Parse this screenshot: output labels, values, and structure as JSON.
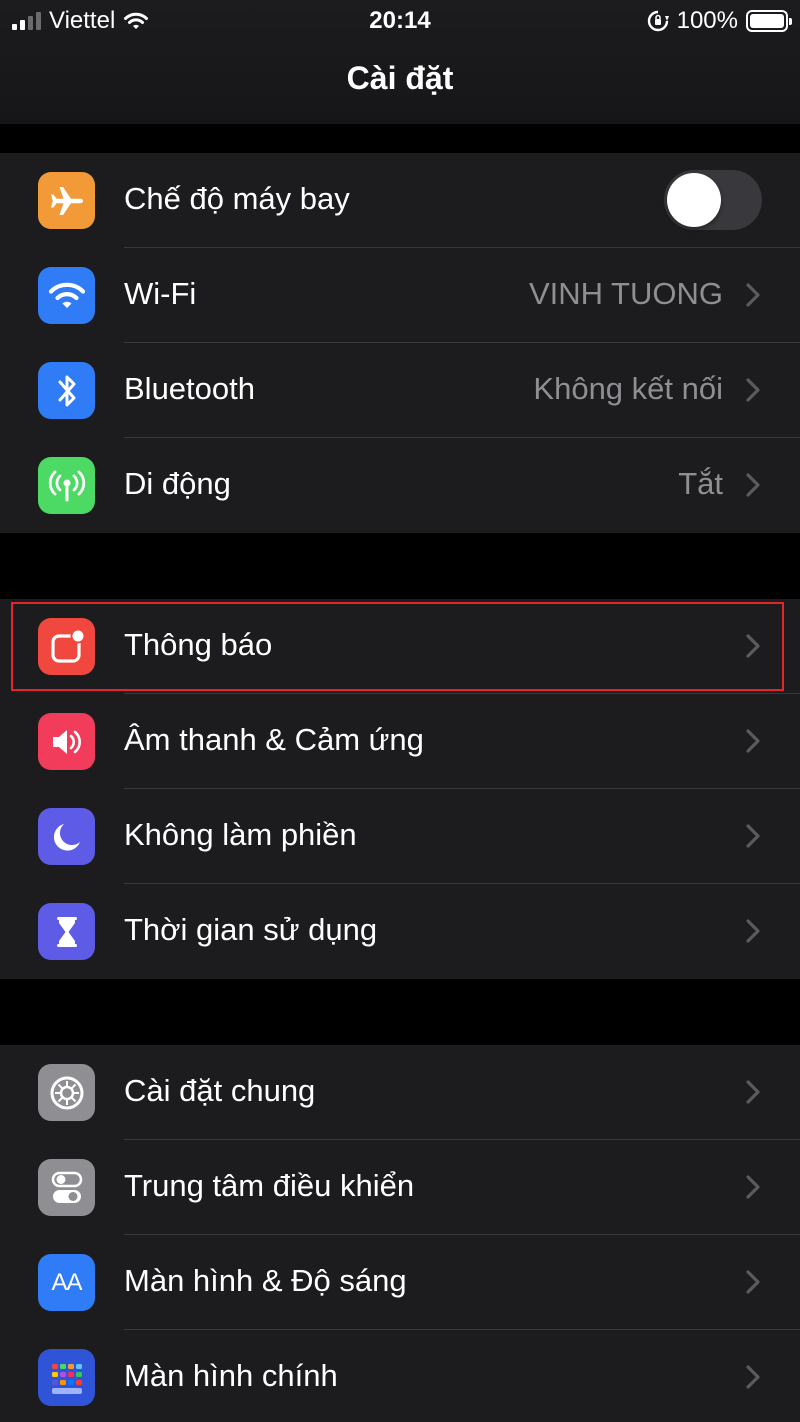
{
  "status_bar": {
    "carrier": "Viettel",
    "time": "20:14",
    "battery": "100%"
  },
  "header": {
    "title": "Cài đặt"
  },
  "groups": [
    {
      "items": [
        {
          "label": "Chế độ máy bay",
          "icon": "airplane-icon",
          "color": "#f19a37",
          "toggle": false
        },
        {
          "label": "Wi-Fi",
          "value": "VINH TUONG",
          "icon": "wifi-icon",
          "color": "#2f7cf6"
        },
        {
          "label": "Bluetooth",
          "value": "Không kết nối",
          "icon": "bluetooth-icon",
          "color": "#2f7cf6"
        },
        {
          "label": "Di động",
          "value": "Tắt",
          "icon": "antenna-icon",
          "color": "#4cd964"
        }
      ]
    },
    {
      "items": [
        {
          "label": "Thông báo",
          "icon": "notifications-icon",
          "color": "#f0483e",
          "highlighted": true
        },
        {
          "label": "Âm thanh & Cảm ứng",
          "icon": "speaker-icon",
          "color": "#f23c5c"
        },
        {
          "label": "Không làm phiền",
          "icon": "moon-icon",
          "color": "#5e5ce6"
        },
        {
          "label": "Thời gian sử dụng",
          "icon": "hourglass-icon",
          "color": "#5e5ce6"
        }
      ]
    },
    {
      "items": [
        {
          "label": "Cài đặt chung",
          "icon": "gear-icon",
          "color": "#8e8e93"
        },
        {
          "label": "Trung tâm điều khiển",
          "icon": "switches-icon",
          "color": "#8e8e93"
        },
        {
          "label": "Màn hình & Độ sáng",
          "icon": "text-size-icon",
          "color": "#2f7cf6",
          "glyph": "AA"
        },
        {
          "label": "Màn hình chính",
          "icon": "home-grid-icon",
          "color": "#2f54d8"
        }
      ]
    }
  ]
}
